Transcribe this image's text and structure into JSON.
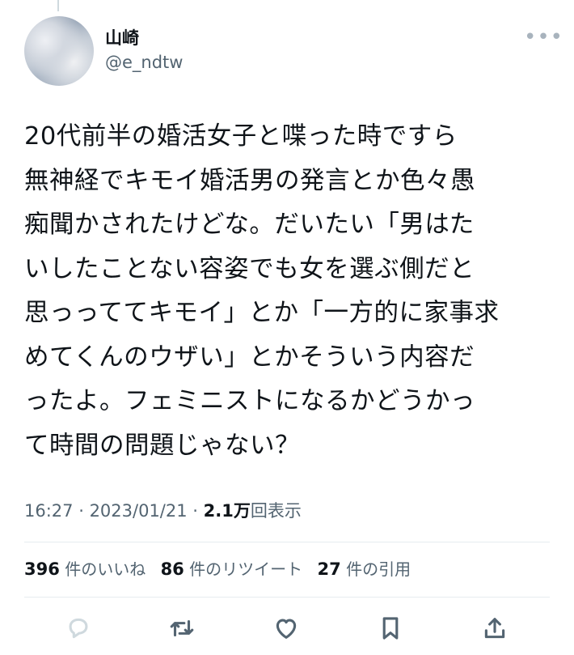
{
  "user": {
    "name": "山崎",
    "handle": "@e_ndtw"
  },
  "more_icon": "more-horizontal-icon",
  "tweet": {
    "text": "20代前半の婚活女子と喋った時ですら\n無神経でキモイ婚活男の発言とか色々愚\n痴聞かされたけどな。だいたい「男はた\nいしたことない容姿でも女を選ぶ側だと\n思っっててキモイ」とか「一方的に家事求\nめてくんのウザい」とかそういう内容だ\nったよ。フェミニストになるかどうかっ\nて時間の問題じゃない？"
  },
  "meta": {
    "time": "16:27",
    "sep1": " · ",
    "date": "2023/01/21",
    "sep2": " · ",
    "views": "2.1万",
    "views_label": "回表示"
  },
  "stats": {
    "likes_count": "396",
    "likes_label": "件のいいね",
    "retweets_count": "86",
    "retweets_label": "件のリツイート",
    "quotes_count": "27",
    "quotes_label": "件の引用"
  },
  "actions": [
    "reply-icon",
    "retweet-icon",
    "like-icon",
    "bookmark-icon",
    "share-icon"
  ],
  "colors": {
    "text": "#0f1419",
    "secondary": "#536471",
    "divider": "#e6ecf0"
  }
}
